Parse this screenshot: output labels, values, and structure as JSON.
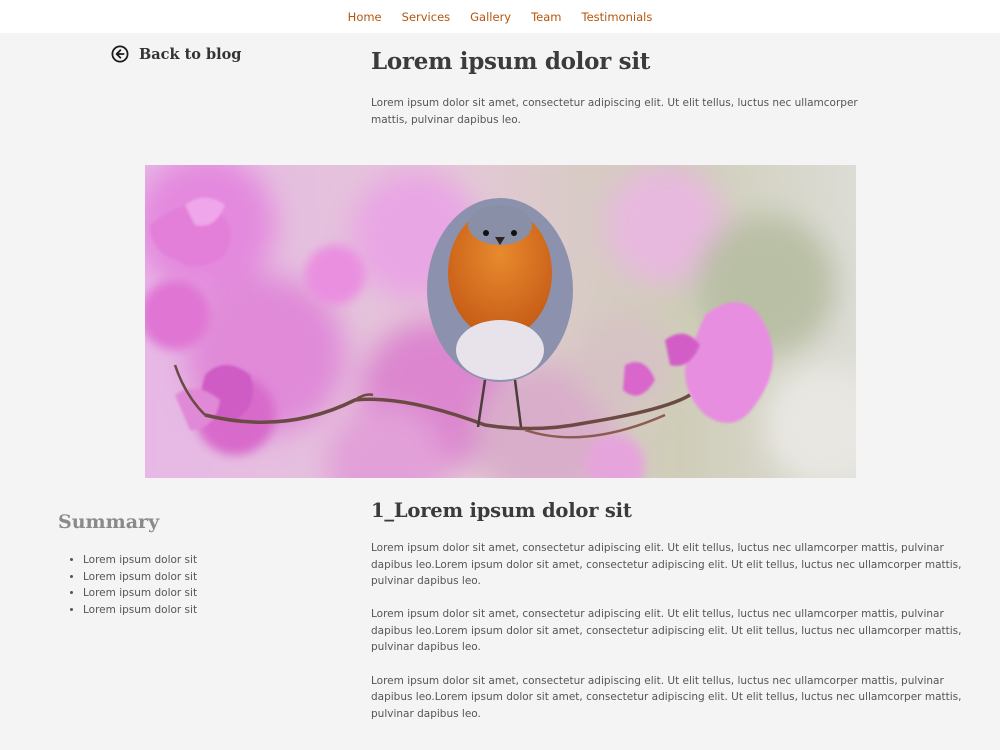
{
  "nav": {
    "items": [
      "Home",
      "Services",
      "Gallery",
      "Team",
      "Testimonials"
    ],
    "link_color": "#b5560d"
  },
  "back": {
    "label": "Back to blog",
    "icon": "arrow-left-circle-icon"
  },
  "post": {
    "title": "Lorem ipsum dolor sit",
    "intro": "Lorem ipsum dolor sit amet, consectetur adipiscing elit. Ut elit tellus, luctus nec ullamcorper mattis, pulvinar dapibus leo."
  },
  "hero_image": {
    "subject": "robin-on-blossom-branch-photo"
  },
  "summary": {
    "title": "Summary",
    "items": [
      "Lorem ipsum dolor sit",
      "Lorem ipsum dolor sit",
      "Lorem ipsum dolor sit",
      "Lorem ipsum dolor sit"
    ]
  },
  "section": {
    "title": "1_Lorem ipsum dolor sit",
    "paragraphs": [
      "Lorem ipsum dolor sit amet, consectetur adipiscing elit. Ut elit tellus, luctus nec ullamcorper mattis, pulvinar dapibus leo.Lorem ipsum dolor sit amet, consectetur adipiscing elit. Ut elit tellus, luctus nec ullamcorper mattis, pulvinar dapibus leo.",
      "Lorem ipsum dolor sit amet, consectetur adipiscing elit. Ut elit tellus, luctus nec ullamcorper mattis, pulvinar dapibus leo.Lorem ipsum dolor sit amet, consectetur adipiscing elit. Ut elit tellus, luctus nec ullamcorper mattis, pulvinar dapibus leo.",
      "Lorem ipsum dolor sit amet, consectetur adipiscing elit. Ut elit tellus, luctus nec ullamcorper mattis, pulvinar dapibus leo.Lorem ipsum dolor sit amet, consectetur adipiscing elit. Ut elit tellus, luctus nec ullamcorper mattis, pulvinar dapibus leo."
    ]
  }
}
